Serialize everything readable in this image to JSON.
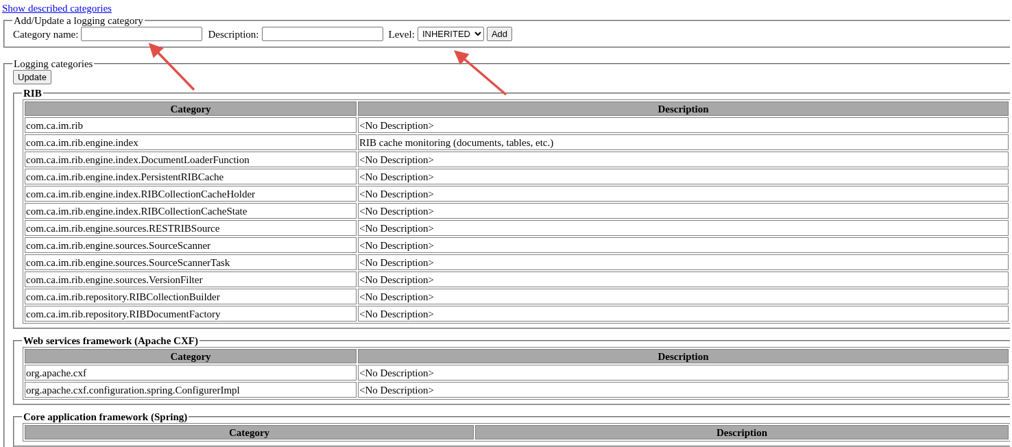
{
  "link": "Show described categories",
  "add_form": {
    "legend": "Add/Update a logging category",
    "name_label": "Category name:",
    "description_label": "Description:",
    "level_label": "Level:",
    "level_value": "INHERITED",
    "add_button": "Add"
  },
  "categories": {
    "legend": "Logging categories",
    "update_button": "Update",
    "groups": [
      {
        "title": "RIB",
        "columns": [
          "Category",
          "Description"
        ],
        "rows": [
          [
            "com.ca.im.rib",
            "<No Description>"
          ],
          [
            "com.ca.im.rib.engine.index",
            "RIB cache monitoring (documents, tables, etc.)"
          ],
          [
            "com.ca.im.rib.engine.index.DocumentLoaderFunction",
            "<No Description>"
          ],
          [
            "com.ca.im.rib.engine.index.PersistentRIBCache",
            "<No Description>"
          ],
          [
            "com.ca.im.rib.engine.index.RIBCollectionCacheHolder",
            "<No Description>"
          ],
          [
            "com.ca.im.rib.engine.index.RIBCollectionCacheState",
            "<No Description>"
          ],
          [
            "com.ca.im.rib.engine.sources.RESTRIBSource",
            "<No Description>"
          ],
          [
            "com.ca.im.rib.engine.sources.SourceScanner",
            "<No Description>"
          ],
          [
            "com.ca.im.rib.engine.sources.SourceScannerTask",
            "<No Description>"
          ],
          [
            "com.ca.im.rib.engine.sources.VersionFilter",
            "<No Description>"
          ],
          [
            "com.ca.im.rib.repository.RIBCollectionBuilder",
            "<No Description>"
          ],
          [
            "com.ca.im.rib.repository.RIBDocumentFactory",
            "<No Description>"
          ]
        ]
      },
      {
        "title": "Web services framework (Apache CXF)",
        "columns": [
          "Category",
          "Description"
        ],
        "rows": [
          [
            "org.apache.cxf",
            "<No Description>"
          ],
          [
            "org.apache.cxf.configuration.spring.ConfigurerImpl",
            "<No Description>"
          ]
        ]
      },
      {
        "title": "Core application framework (Spring)",
        "columns": [
          "Category",
          "Description"
        ]
      }
    ]
  }
}
